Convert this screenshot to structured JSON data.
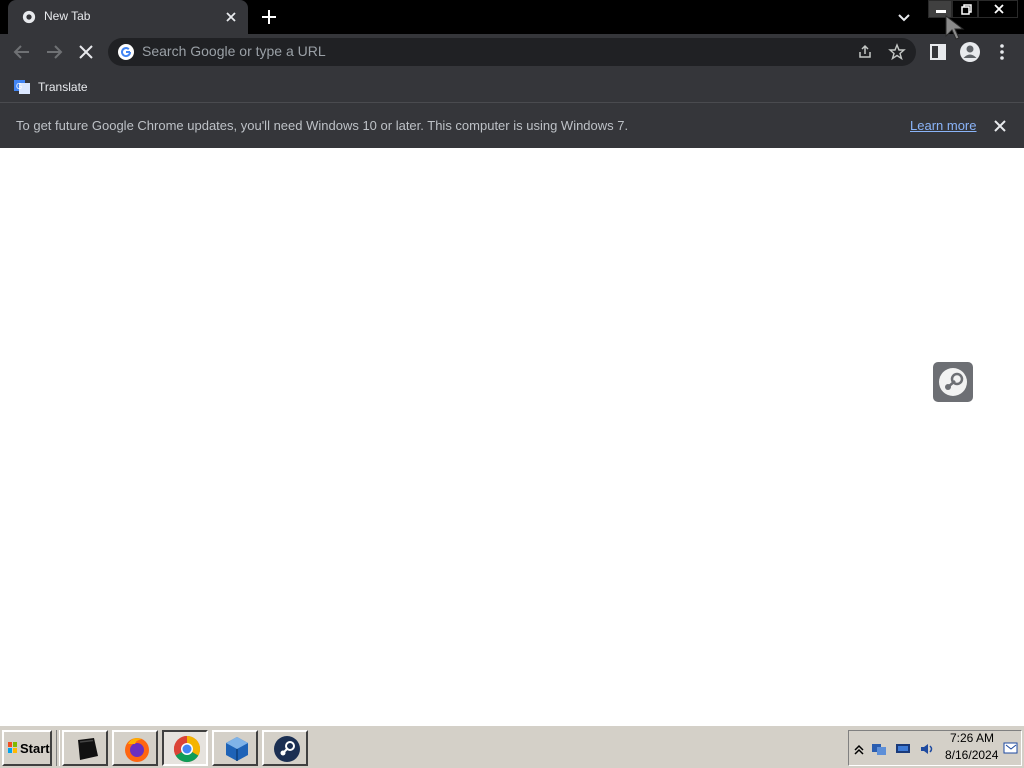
{
  "browser": {
    "tab": {
      "title": "New Tab",
      "icon": "chrome-favicon-icon"
    },
    "window_controls": [
      "minimize-icon",
      "restore-icon",
      "close-icon"
    ],
    "omnibox": {
      "placeholder": "Search Google or type a URL",
      "value": ""
    },
    "bookmarks": [
      {
        "label": "Translate",
        "icon": "google-translate-icon"
      }
    ],
    "infobar": {
      "message": "To get future Google Chrome updates, you'll need Windows 10 or later. This computer is using Windows 7.",
      "link": "Learn more"
    },
    "colors": {
      "frame": "#000000",
      "toolbar": "#35363a",
      "omnibox": "#202124",
      "text": "#e8eaed",
      "link": "#8ab4f8"
    }
  },
  "desktop": {
    "icons": [
      "steam-icon"
    ]
  },
  "taskbar": {
    "start_label": "Start",
    "apps": [
      "terminal-icon",
      "firefox-icon",
      "chrome-icon",
      "virtualbox-icon",
      "steam-icon"
    ],
    "tray_icons": [
      "show-hidden-icon",
      "network-icon",
      "display-icon",
      "volume-icon"
    ],
    "clock": {
      "time": "7:26 AM",
      "date": "8/16/2024"
    }
  }
}
